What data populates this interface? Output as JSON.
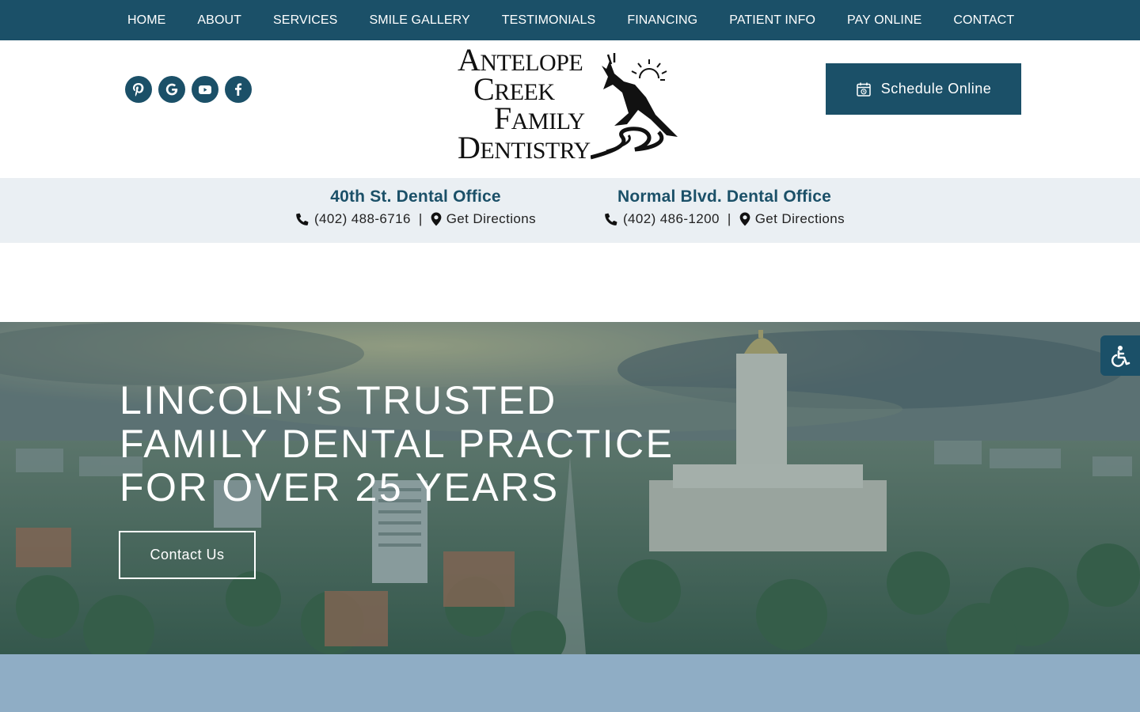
{
  "nav": {
    "items": [
      "HOME",
      "ABOUT",
      "SERVICES",
      "SMILE GALLERY",
      "TESTIMONIALS",
      "FINANCING",
      "PATIENT INFO",
      "PAY ONLINE",
      "CONTACT"
    ]
  },
  "header": {
    "social": [
      "pinterest-icon",
      "google-icon",
      "youtube-icon",
      "facebook-icon"
    ],
    "logo": {
      "line1_initial": "A",
      "line1_rest": "NTELOPE",
      "line2_initial": "C",
      "line2_rest": "REEK",
      "line3_initial": "F",
      "line3_rest": "AMILY",
      "line4_initial": "D",
      "line4_rest": "ENTISTRY"
    },
    "schedule_label": "Schedule Online"
  },
  "offices": [
    {
      "name": "40th St. Dental Office",
      "phone": "(402) 488-6716",
      "separator": "|",
      "directions": "Get Directions"
    },
    {
      "name": "Normal Blvd. Dental Office",
      "phone": "(402) 486-1200",
      "separator": "|",
      "directions": "Get Directions"
    }
  ],
  "hero": {
    "title_lines": [
      "LINCOLN’S TRUSTED",
      "FAMILY DENTAL PRACTICE",
      "FOR OVER 25 YEARS"
    ],
    "cta_label": "Contact Us"
  },
  "colors": {
    "brand": "#1b5068",
    "office_strip": "#eaeff3",
    "footer_band": "#8fadc5"
  }
}
